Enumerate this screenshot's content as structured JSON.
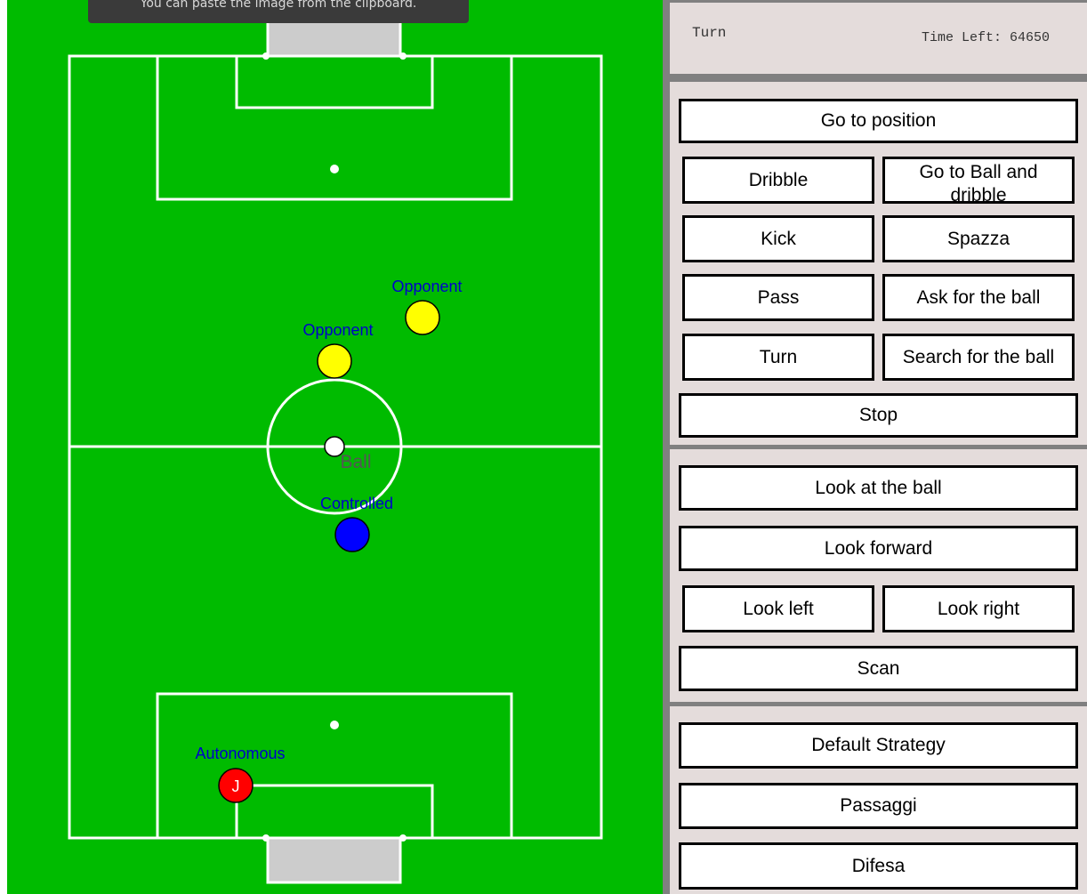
{
  "toast": {
    "text": "You can paste the image from the clipboard."
  },
  "field": {
    "players": [
      {
        "label": "Opponent",
        "color": "#ffff00"
      },
      {
        "label": "Opponent",
        "color": "#ffff00"
      },
      {
        "label": "Controlled",
        "color": "#0000ff"
      },
      {
        "label": "Autonomous",
        "color": "#ff0000",
        "marker": "J"
      }
    ],
    "ball": {
      "label": "Ball"
    },
    "colors": {
      "grass": "#00bb00",
      "lines": "#ffffff",
      "goal": "#cccccc",
      "label": "#0000cc"
    }
  },
  "status": {
    "title": "Turn",
    "time_left": "Time Left: 64650"
  },
  "actions": {
    "go_to_position": "Go to position",
    "dribble": "Dribble",
    "go_to_ball_dribble": "Go to Ball and dribble",
    "kick": "Kick",
    "spazza": "Spazza",
    "pass": "Pass",
    "ask_for_ball": "Ask for the ball",
    "turn": "Turn",
    "search_for_ball": "Search for the ball",
    "stop": "Stop"
  },
  "look": {
    "look_at_ball": "Look at the ball",
    "look_forward": "Look forward",
    "look_left": "Look left",
    "look_right": "Look right",
    "scan": "Scan"
  },
  "strategy": {
    "default": "Default Strategy",
    "passaggi": "Passaggi",
    "difesa": "Difesa"
  }
}
